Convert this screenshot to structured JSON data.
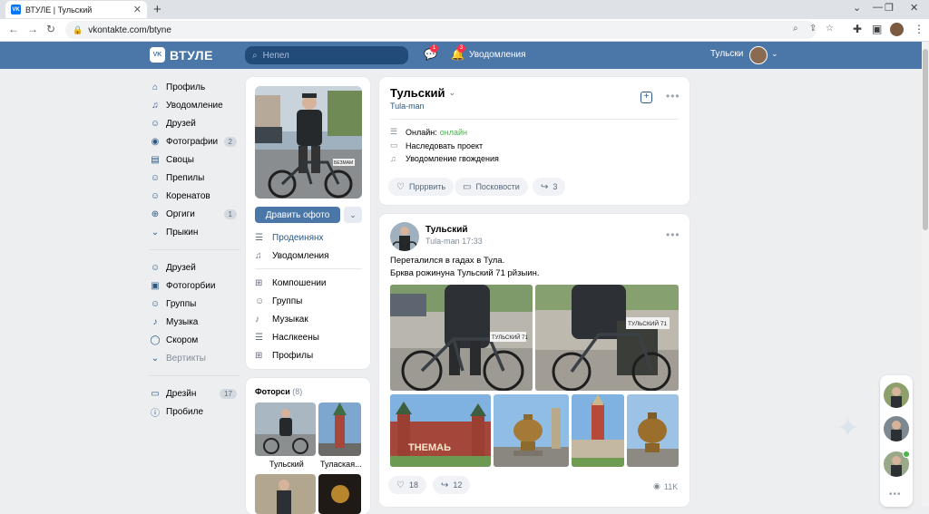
{
  "browser": {
    "tab_title": "ВТУЛЕ | Тульский",
    "tab_close": "✕",
    "new_tab": "+",
    "url": "vkontakte.com/btyne"
  },
  "header": {
    "logo_text": "ВТУЛЕ",
    "logo_mark": "VK",
    "search_placeholder": "Непел",
    "messages_badge": "1",
    "notifications_badge": "3",
    "notifications_label": "Уводомления",
    "user_name": "Тульски"
  },
  "left_nav": {
    "top": [
      {
        "label": "Профиль",
        "icon": "home-icon",
        "glyph": "⌂"
      },
      {
        "label": "Уводомление",
        "icon": "bell-icon",
        "glyph": "♫"
      },
      {
        "label": "Друзей",
        "icon": "friends-icon",
        "glyph": "☺"
      },
      {
        "label": "Фотографии",
        "icon": "camera-icon",
        "glyph": "◉",
        "count": "2"
      },
      {
        "label": "Своцы",
        "icon": "list-icon",
        "glyph": "▤"
      },
      {
        "label": "Препилы",
        "icon": "people-icon",
        "glyph": "☺"
      },
      {
        "label": "Коренатов",
        "icon": "users-icon",
        "glyph": "☺"
      },
      {
        "label": "Оргиги",
        "icon": "plus-circle-icon",
        "glyph": "⊕",
        "count": "1"
      },
      {
        "label": "Прыкин",
        "icon": "chevron-down-icon",
        "glyph": "⌄"
      }
    ],
    "middle": [
      {
        "label": "Друзей",
        "icon": "friends-icon",
        "glyph": "☺"
      },
      {
        "label": "Фотогорбии",
        "icon": "photo-icon",
        "glyph": "▣"
      },
      {
        "label": "Группы",
        "icon": "group-icon",
        "glyph": "☺"
      },
      {
        "label": "Музыка",
        "icon": "music-icon",
        "glyph": "♪"
      },
      {
        "label": "Скором",
        "icon": "play-icon",
        "glyph": "◯"
      },
      {
        "label": "Вертикты",
        "icon": "chevron-down-icon",
        "glyph": "⌄",
        "muted": true
      }
    ],
    "bottom": [
      {
        "label": "Дрезйн",
        "icon": "document-icon",
        "glyph": "▭",
        "count": "17"
      },
      {
        "label": "Пробиле",
        "icon": "info-icon",
        "glyph": "ⓘ"
      }
    ]
  },
  "profile_card": {
    "primary_button": "Дравить офото",
    "plate_text": "БЕЗМАМ",
    "links": [
      {
        "label": "Продеинянх",
        "icon": "menu-icon",
        "glyph": "☰",
        "blue": true
      },
      {
        "label": "Уводомления",
        "icon": "bell-icon",
        "glyph": "♫"
      },
      {
        "label": "Компошении",
        "icon": "apps-icon",
        "glyph": "⊞"
      },
      {
        "label": "Группы",
        "icon": "group-icon",
        "glyph": "☺"
      },
      {
        "label": "Музыкак",
        "icon": "music-icon",
        "glyph": "♪"
      },
      {
        "label": "Наслкеены",
        "icon": "list-icon",
        "glyph": "☰"
      },
      {
        "label": "Профилы",
        "icon": "grid-icon",
        "glyph": "⊞"
      }
    ]
  },
  "photos_card": {
    "title": "Фоторси",
    "count": "(8)",
    "items": [
      {
        "caption": "Тульский"
      },
      {
        "caption": "Тулаская..."
      }
    ]
  },
  "profile_header": {
    "name": "Тульский",
    "username": "Tula-man",
    "info": [
      {
        "label": "Онлайн:",
        "value": "онлайн",
        "icon": "menu-icon",
        "glyph": "☰"
      },
      {
        "label": "Наследовать проект",
        "icon": "video-icon",
        "glyph": "▭"
      },
      {
        "label": "Уводомление гвождения",
        "icon": "bell-icon",
        "glyph": "♫"
      }
    ],
    "actions": [
      {
        "label": "Прррвить",
        "icon": "heart-icon",
        "glyph": "♡"
      },
      {
        "label": "Посковости",
        "icon": "comment-icon",
        "glyph": "▭"
      },
      {
        "label": "3",
        "icon": "share-icon",
        "glyph": "↪"
      }
    ]
  },
  "post": {
    "author": "Тульский",
    "meta": "Tula-man 17:33",
    "text_line1": "Переталился в гадах в Тула.",
    "text_line2": "Брква рожинуна Тульский 71 рйзыин.",
    "plate1": "ТУЛЬСКИЙ 71",
    "plate2": "ТУЛЬСКИЙ 71",
    "kremlin_sign": "ТНЕМАЬ",
    "likes": "18",
    "shares": "12",
    "views": "11K"
  },
  "colors": {
    "header": "#4a76a8",
    "accent": "#2a5885",
    "online": "#4bb34b",
    "badge": "#ff3347"
  }
}
